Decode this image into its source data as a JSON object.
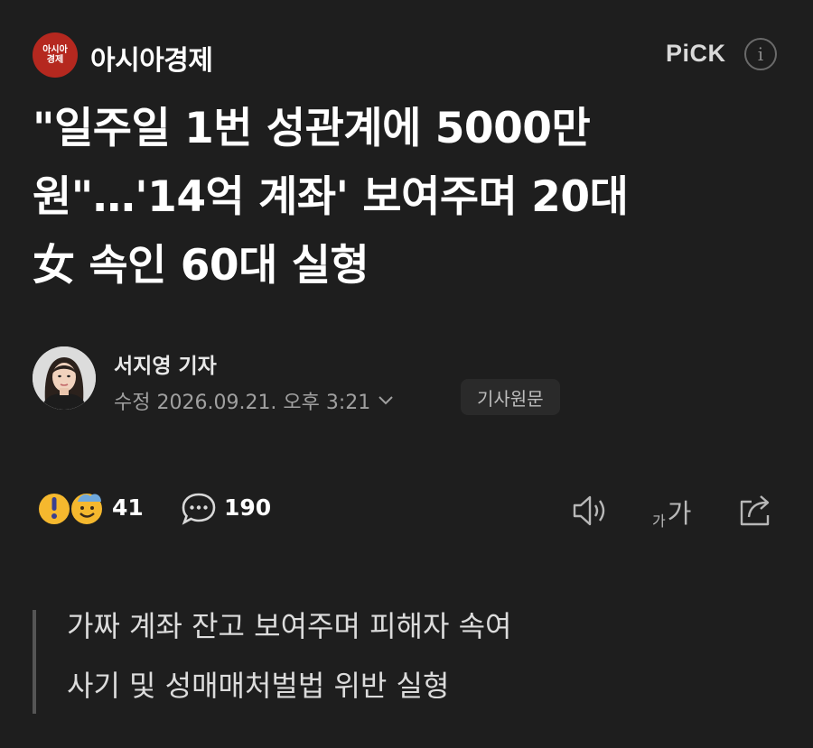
{
  "header": {
    "press_logo_text": [
      "아시아",
      "경제"
    ],
    "press_name": "아시아경제",
    "pick_label": "PiCK",
    "info_icon": "info-icon"
  },
  "article": {
    "headline_lines": [
      "\"일주일 1번 성관계에 5000만",
      "원\"…'14억 계좌' 보여주며 20대",
      "女 속인 60대 실형"
    ],
    "author": "서지영 기자",
    "date_label": "수정 2026.09.21. 오후 3:21",
    "origin_button": "기사원문"
  },
  "stats": {
    "reaction_icons": [
      "surprised-emoji-icon",
      "smile-emoji-icon"
    ],
    "reaction_count": "41",
    "comment_icon": "comment-bubble-icon",
    "comment_count": "190",
    "speaker_icon": "speaker-icon",
    "font_small": "가",
    "font_big": "가",
    "share_icon": "share-icon"
  },
  "summary": {
    "lines": [
      "가짜 계좌 잔고 보여주며 피해자 속여",
      "사기 및 성매매처벌법 위반 실형"
    ]
  },
  "colors": {
    "background": "#1e1e1e",
    "logo_red": "#b5281f",
    "text": "#ffffff",
    "muted": "#a0a0a0"
  }
}
